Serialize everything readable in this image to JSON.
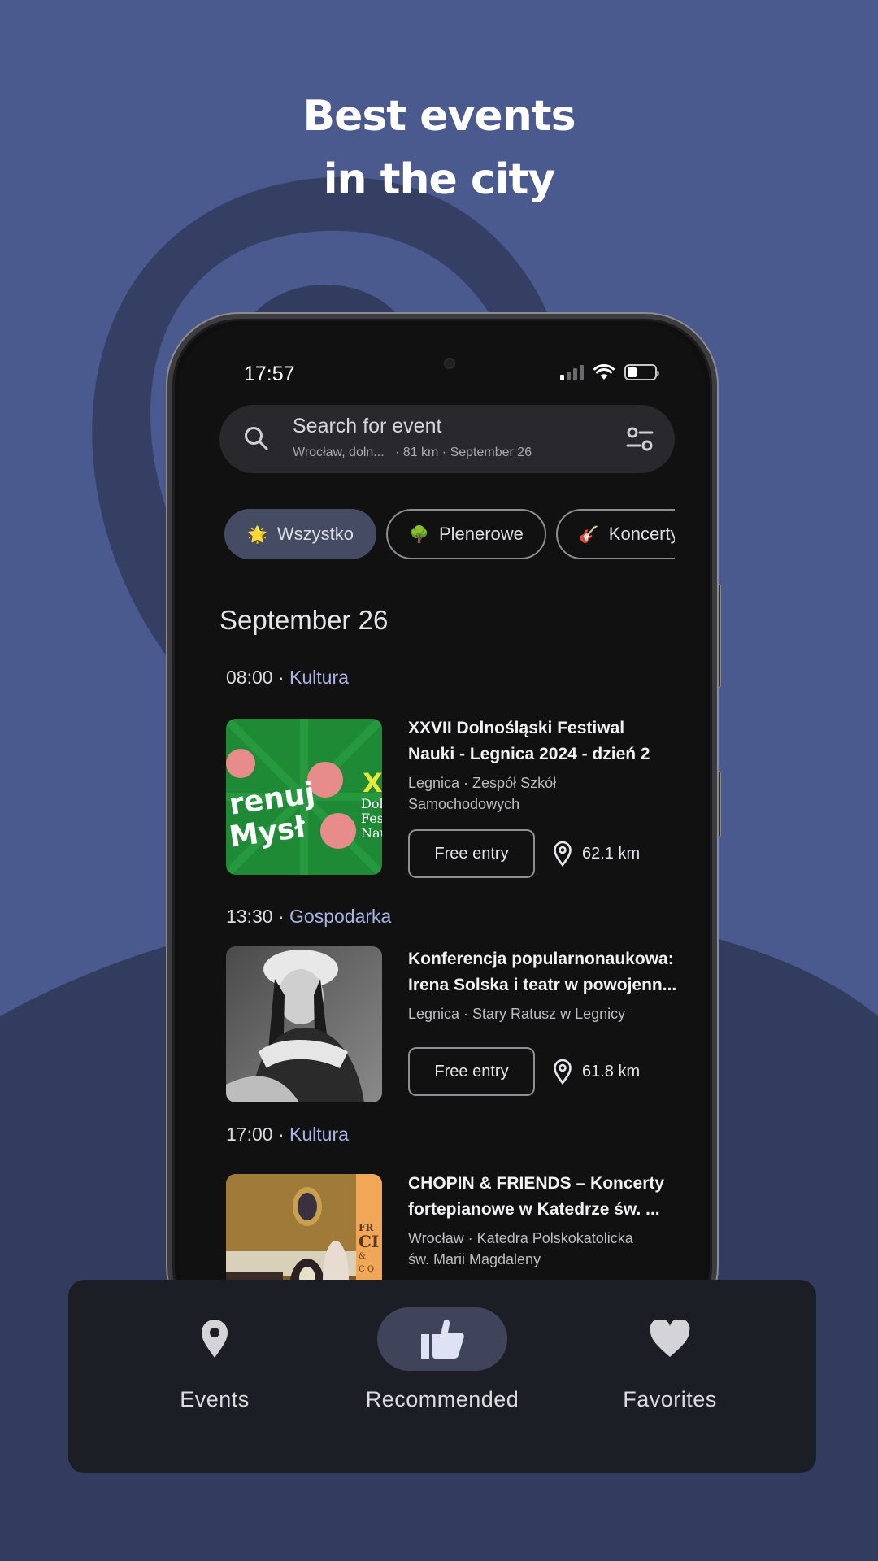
{
  "headline": {
    "line1": "Best events",
    "line2": "in the city"
  },
  "colors": {
    "background": "#4a5a8f",
    "background_dark": "#323c5e",
    "accent_category": "#a9b4e6",
    "active_chip": "#444b62",
    "nav_bar": "#1c1e25"
  },
  "status_bar": {
    "time": "17:57",
    "signal_bars": 1,
    "signal_total": 4,
    "battery_level": 0.35,
    "icons": [
      "signal-icon",
      "wifi-icon",
      "battery-icon"
    ]
  },
  "search": {
    "placeholder": "Search for event",
    "location": "Wrocław, doln...",
    "radius": "81 km",
    "date": "September 26",
    "separator": "·"
  },
  "chips": [
    {
      "emoji": "🌟",
      "label": "Wszystko",
      "active": true
    },
    {
      "emoji": "🌳",
      "label": "Plenerowe",
      "active": false
    },
    {
      "emoji": "🎸",
      "label": "Koncerty",
      "active": false
    }
  ],
  "date_header": "September 26",
  "events": [
    {
      "time": "08:00",
      "category": "Kultura",
      "title_line1": "XXVII Dolnośląski Festiwal",
      "title_line2": "Nauki - Legnica 2024 - dzień 2",
      "location_line1": "Legnica · Zespół Szkół",
      "location_line2": "Samochodowych",
      "price": "Free entry",
      "distance": "62.1 km",
      "thumb_text": "Trenuj Umysł"
    },
    {
      "time": "13:30",
      "category": "Gospodarka",
      "title_line1": "Konferencja popularnonaukowa:",
      "title_line2": "Irena Solska i teatr w powojenn...",
      "location_line1": "Legnica · Stary Ratusz w Legnicy",
      "location_line2": "",
      "price": "Free entry",
      "distance": "61.8 km"
    },
    {
      "time": "17:00",
      "category": "Kultura",
      "title_line1": "CHOPIN & FRIENDS – Koncerty",
      "title_line2": "fortepianowe w Katedrze św. ...",
      "location_line1": "Wrocław · Katedra Polskokatolicka",
      "location_line2": "św. Marii Magdaleny"
    }
  ],
  "bottom_nav": [
    {
      "label": "Events",
      "icon": "map-pin-icon",
      "active": false
    },
    {
      "label": "Recommended",
      "icon": "thumbs-up-icon",
      "active": true
    },
    {
      "label": "Favorites",
      "icon": "heart-icon",
      "active": false
    }
  ]
}
